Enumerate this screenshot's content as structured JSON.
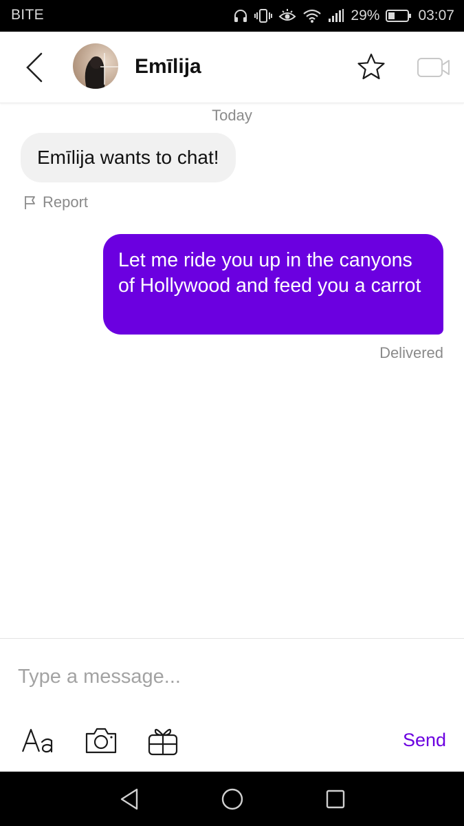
{
  "status_bar": {
    "carrier": "BITE",
    "battery_percent": "29%",
    "time": "03:07",
    "icons": [
      "headphones-icon",
      "vibrate-icon",
      "eye-comfort-icon",
      "wifi-icon",
      "signal-icon",
      "battery-icon"
    ]
  },
  "header": {
    "contact_name": "Emīlija",
    "back_icon": "chevron-left-icon",
    "favorite_icon": "star-outline-icon",
    "video_icon": "video-camera-icon"
  },
  "conversation": {
    "day_label": "Today",
    "incoming_message": "Emīlija wants to chat!",
    "report_label": "Report",
    "outgoing_message": "Let me ride you up in the canyons of Hollywood and feed you a carrot",
    "delivery_status": "Delivered"
  },
  "composer": {
    "placeholder": "Type a message...",
    "value": "",
    "send_label": "Send",
    "tools": [
      "text-style-icon",
      "camera-icon",
      "gift-icon"
    ]
  },
  "navigation": {
    "buttons": [
      "back-triangle-icon",
      "home-circle-icon",
      "recents-square-icon"
    ]
  },
  "colors": {
    "accent": "#6b00e0",
    "incoming_bubble": "#f1f1f1",
    "meta_text": "#8a8a8a",
    "system_bar": "#000000"
  }
}
